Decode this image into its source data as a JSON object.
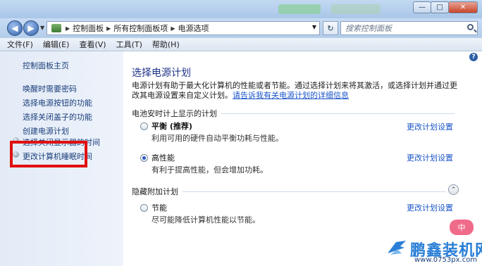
{
  "window": {
    "controls": {
      "minimize": "—",
      "maximize": "□",
      "close": "✕"
    }
  },
  "nav": {
    "back_icon": "back-arrow-icon",
    "forward_icon": "forward-arrow-icon",
    "breadcrumb": [
      "控制面板",
      "所有控制面板项",
      "电源选项"
    ],
    "search_placeholder": "搜索控制面板"
  },
  "menu": [
    "文件(F)",
    "编辑(E)",
    "查看(V)",
    "工具(T)",
    "帮助(H)"
  ],
  "sidebar": {
    "home": "控制面板主页",
    "items": [
      "唤醒时需要密码",
      "选择电源按钮的功能",
      "选择关闭盖子的功能",
      "创建电源计划",
      "选择关闭显示器的时间",
      "更改计算机睡眠时间"
    ]
  },
  "main": {
    "heading": "选择电源计划",
    "description": "电源计划有助于最大化计算机的性能或者节能。通过选择计划来将其激活，或选择计划并通过更改其电源设置来自定义计划。",
    "description_link": "请告诉我有关电源计划的详细信息",
    "section1": "电池安时计上显示的计划",
    "section2": "隐藏附加计划",
    "plans": [
      {
        "name": "平衡 (推荐)",
        "desc": "利用可用的硬件自动平衡功耗与性能。",
        "change": "更改计划设置",
        "selected": false
      },
      {
        "name": "高性能",
        "desc": "有利于提高性能，但会增加功耗。",
        "change": "更改计划设置",
        "selected": true
      },
      {
        "name": "节能",
        "desc": "尽可能降低计算机性能以节能。",
        "change": "更改计划设置",
        "selected": false
      }
    ]
  },
  "watermark": {
    "bubble": "中",
    "brand": "鹏鑫装机网",
    "url": "www.0753px.com"
  },
  "colors": {
    "link": "#1a55c8",
    "heading": "#1e3287",
    "highlight_box": "#e01010"
  }
}
